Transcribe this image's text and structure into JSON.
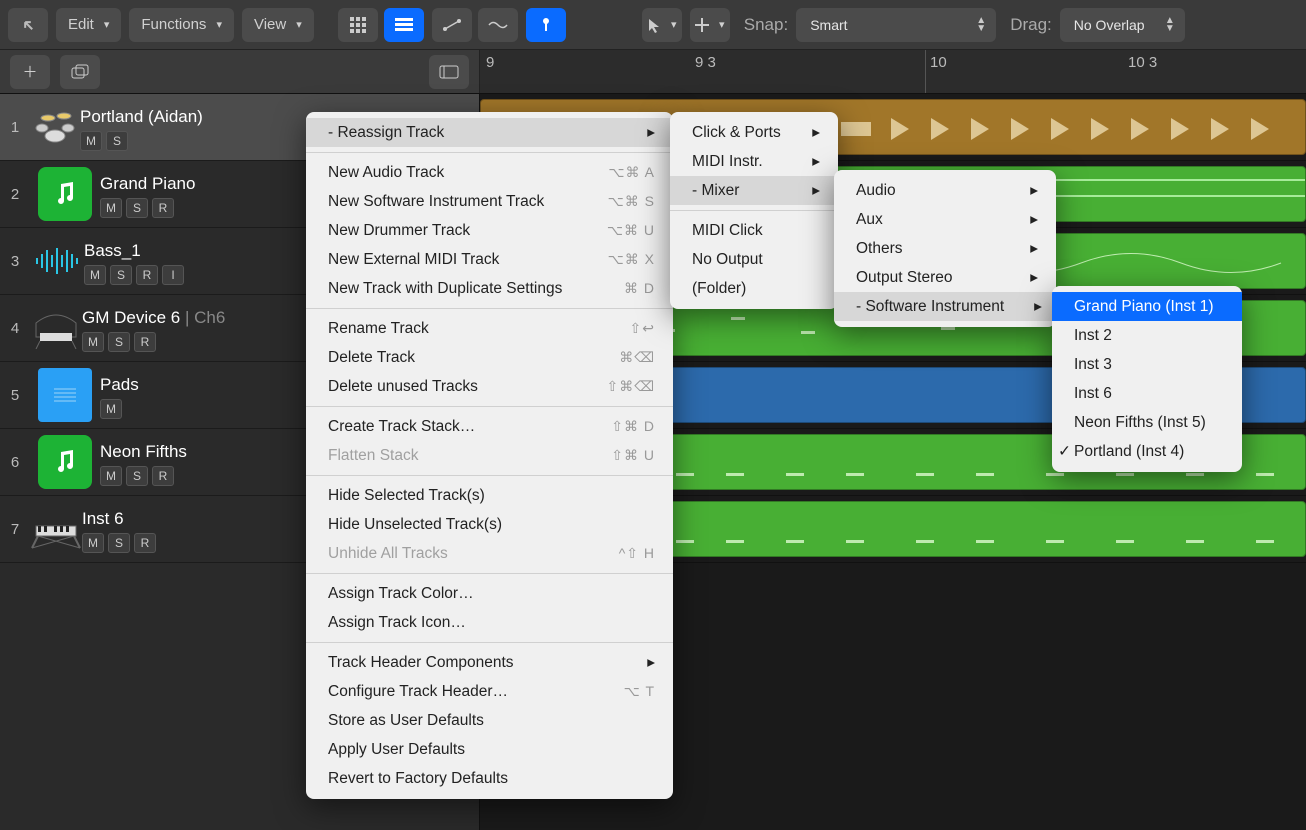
{
  "toolbar": {
    "edit": "Edit",
    "functions": "Functions",
    "view": "View",
    "snap_label": "Snap:",
    "snap_value": "Smart",
    "drag_label": "Drag:",
    "drag_value": "No Overlap"
  },
  "ruler": {
    "marks": [
      "9",
      "9 3",
      "10",
      "10 3"
    ]
  },
  "tracks": [
    {
      "num": "1",
      "name": "Portland (Aidan)",
      "extra": "",
      "buttons": [
        "M",
        "S"
      ],
      "icon": "drums",
      "selected": true
    },
    {
      "num": "2",
      "name": "Grand Piano",
      "extra": "",
      "buttons": [
        "M",
        "S",
        "R"
      ],
      "icon": "notes-green"
    },
    {
      "num": "3",
      "name": "Bass_1",
      "extra": "",
      "buttons": [
        "M",
        "S",
        "R",
        "I"
      ],
      "icon": "waveform"
    },
    {
      "num": "4",
      "name": "GM Device 6",
      "extra": " | Ch6",
      "buttons": [
        "M",
        "S",
        "R"
      ],
      "icon": "piano"
    },
    {
      "num": "5",
      "name": "Pads",
      "extra": "",
      "buttons": [
        "M"
      ],
      "icon": "folder"
    },
    {
      "num": "6",
      "name": "Neon Fifths",
      "extra": "",
      "buttons": [
        "M",
        "S",
        "R"
      ],
      "icon": "notes-green"
    },
    {
      "num": "7",
      "name": "Inst 6",
      "extra": "",
      "buttons": [
        "M",
        "S",
        "R"
      ],
      "icon": "keyboard"
    }
  ],
  "context_menu": {
    "items": [
      {
        "label": "- Reassign Track",
        "sub": true,
        "hl": true
      },
      {
        "sep": true
      },
      {
        "label": "New Audio Track",
        "sc": "⌥⌘ A"
      },
      {
        "label": "New Software Instrument Track",
        "sc": "⌥⌘ S"
      },
      {
        "label": "New Drummer Track",
        "sc": "⌥⌘ U"
      },
      {
        "label": "New External MIDI Track",
        "sc": "⌥⌘ X"
      },
      {
        "label": "New Track with Duplicate Settings",
        "sc": "⌘ D"
      },
      {
        "sep": true
      },
      {
        "label": "Rename Track",
        "sc": "⇧↩"
      },
      {
        "label": "Delete Track",
        "sc": "⌘⌫"
      },
      {
        "label": "Delete unused Tracks",
        "sc": "⇧⌘⌫"
      },
      {
        "sep": true
      },
      {
        "label": "Create Track Stack…",
        "sc": "⇧⌘ D"
      },
      {
        "label": "Flatten Stack",
        "sc": "⇧⌘ U",
        "dis": true
      },
      {
        "sep": true
      },
      {
        "label": "Hide Selected Track(s)"
      },
      {
        "label": "Hide Unselected Track(s)"
      },
      {
        "label": "Unhide All Tracks",
        "sc": "^⇧ H",
        "dis": true
      },
      {
        "sep": true
      },
      {
        "label": "Assign Track Color…"
      },
      {
        "label": "Assign Track Icon…"
      },
      {
        "sep": true
      },
      {
        "label": "Track Header Components",
        "sub": true
      },
      {
        "label": "Configure Track Header…",
        "sc": "⌥ T"
      },
      {
        "label": "Store as User Defaults"
      },
      {
        "label": "Apply User Defaults"
      },
      {
        "label": "Revert to Factory Defaults"
      }
    ]
  },
  "submenu1": {
    "items": [
      {
        "label": "Click & Ports",
        "sub": true
      },
      {
        "label": "MIDI Instr.",
        "sub": true
      },
      {
        "label": "- Mixer",
        "sub": true,
        "hl": true
      },
      {
        "sep": true
      },
      {
        "label": "MIDI Click"
      },
      {
        "label": "No Output"
      },
      {
        "label": "(Folder)"
      }
    ]
  },
  "submenu2": {
    "items": [
      {
        "label": "Audio",
        "sub": true
      },
      {
        "label": "Aux",
        "sub": true
      },
      {
        "label": "Others",
        "sub": true
      },
      {
        "label": "Output Stereo",
        "sub": true
      },
      {
        "label": "- Software Instrument",
        "sub": true,
        "hl": true
      }
    ]
  },
  "submenu3": {
    "items": [
      {
        "label": "Grand Piano (Inst 1)",
        "sel": true
      },
      {
        "label": "Inst 2"
      },
      {
        "label": "Inst 3"
      },
      {
        "label": "Inst 6"
      },
      {
        "label": "Neon Fifths (Inst 5)"
      },
      {
        "label": "Portland (Inst 4)",
        "check": true
      }
    ]
  }
}
